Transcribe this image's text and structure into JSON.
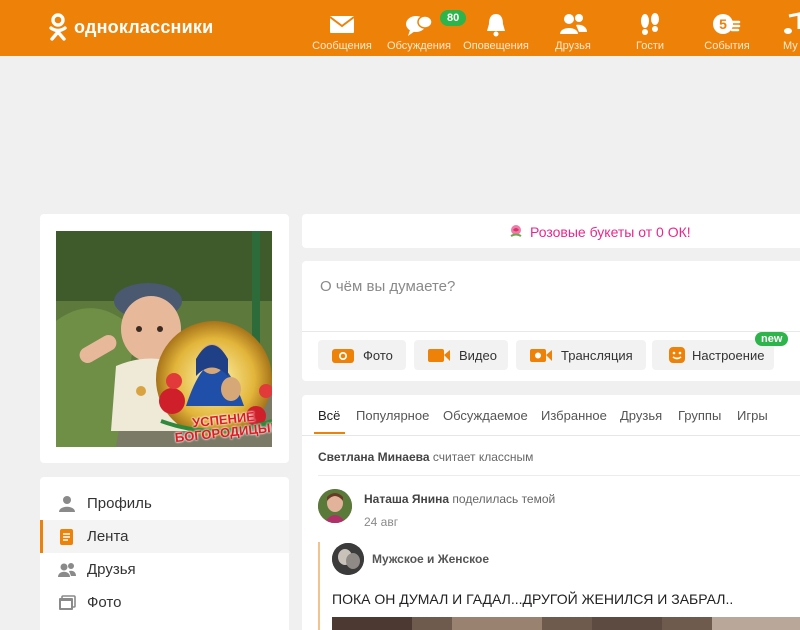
{
  "brand": {
    "name": "одноклассники",
    "color": "#ee8208"
  },
  "nav": [
    {
      "label": "Сообщения",
      "icon": "envelope-icon"
    },
    {
      "label": "Обсуждения",
      "icon": "chat-bubbles-icon",
      "badge": "80"
    },
    {
      "label": "Оповещения",
      "icon": "bell-icon"
    },
    {
      "label": "Друзья",
      "icon": "friends-icon"
    },
    {
      "label": "Гости",
      "icon": "footprints-icon"
    },
    {
      "label": "События",
      "icon": "events-icon",
      "count": "5"
    },
    {
      "label": "Му",
      "icon": "music-note-icon"
    }
  ],
  "avatar": {
    "caption_line1": "УСПЕНИЕ",
    "caption_line2": "БОГОРОДИЦЫ!"
  },
  "left_menu": [
    {
      "label": "Профиль",
      "icon": "person-icon",
      "active": false
    },
    {
      "label": "Лента",
      "icon": "feed-icon",
      "active": true
    },
    {
      "label": "Друзья",
      "icon": "friends-icon",
      "active": false
    },
    {
      "label": "Фото",
      "icon": "photo-icon",
      "active": false
    }
  ],
  "promo": {
    "text": "Розовые букеты от 0 ОК!",
    "icon": "rose-icon",
    "color": "#e8278c"
  },
  "composer": {
    "placeholder": "О чём вы думаете?",
    "buttons": [
      {
        "label": "Фото",
        "icon": "camera-icon"
      },
      {
        "label": "Видео",
        "icon": "video-icon"
      },
      {
        "label": "Трансляция",
        "icon": "broadcast-icon"
      },
      {
        "label": "Настроение",
        "icon": "smiley-icon",
        "badge": "new"
      }
    ]
  },
  "feed": {
    "tabs": [
      "Всё",
      "Популярное",
      "Обсуждаемое",
      "Избранное",
      "Друзья",
      "Группы",
      "Игры"
    ],
    "active_tab": "Всё",
    "like_notice": {
      "name": "Светлана Минаева",
      "action": "считает классным"
    },
    "post": {
      "author": "Наташа Янина",
      "action": "поделилась темой",
      "date": "24 авг",
      "group": "Мужское и Женское",
      "text": "ПОКА ОН ДУМАЛ И ГАДАЛ...ДРУГОЙ ЖЕНИЛСЯ И ЗАБРАЛ.."
    }
  },
  "colors": {
    "accent": "#ee8208",
    "badge_green": "#2db44a",
    "background": "#f0f0f0"
  }
}
